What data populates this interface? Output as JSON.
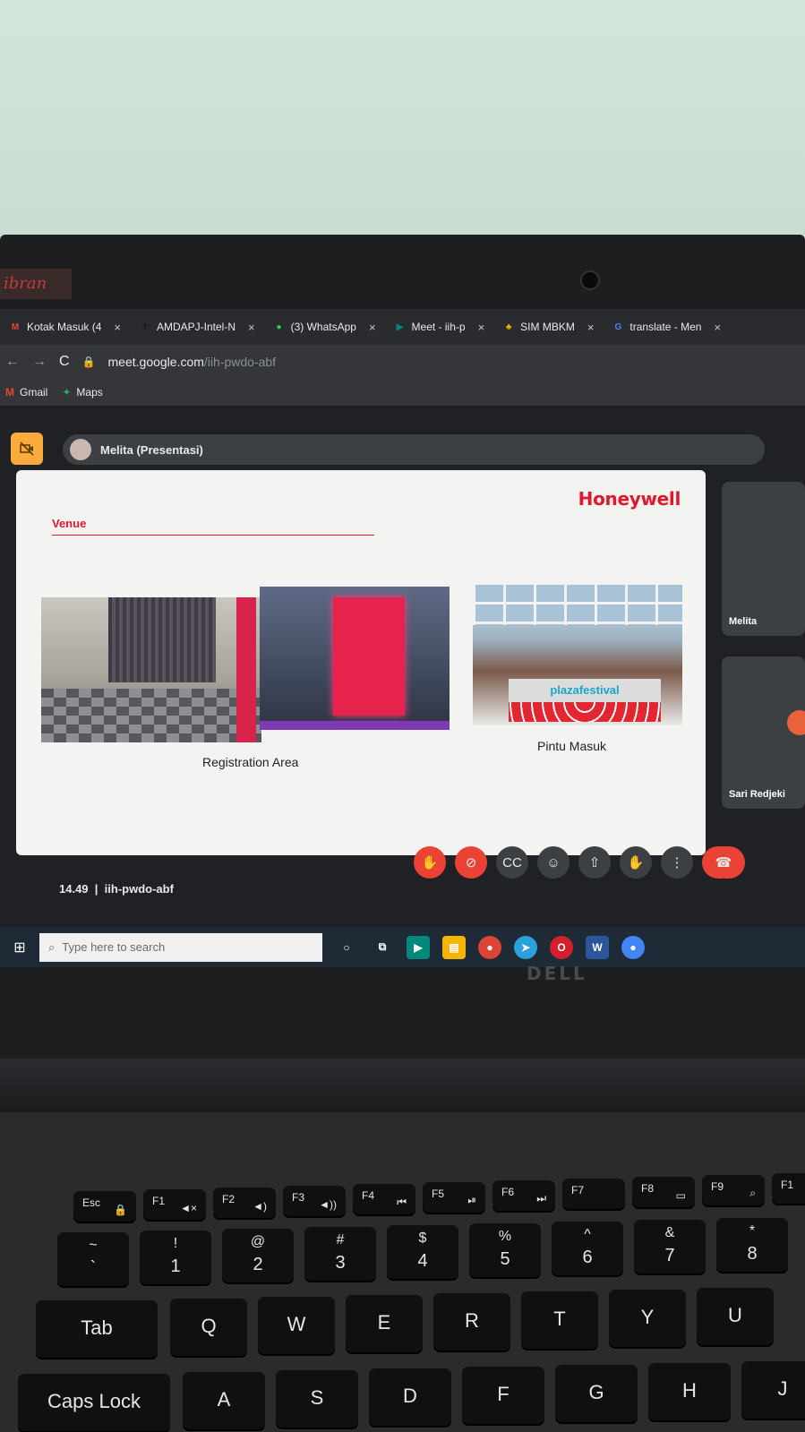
{
  "browser": {
    "tabs": [
      {
        "icon": "gmail-icon",
        "icon_text": "M",
        "icon_color": "#ea4335",
        "label": "Kotak Masuk (4",
        "close": "×"
      },
      {
        "icon": "amdapj-icon",
        "icon_text": "✝",
        "icon_color": "#1a1a1a",
        "label": "AMDAPJ-Intel-N",
        "close": "×"
      },
      {
        "icon": "whatsapp-icon",
        "icon_text": "●",
        "icon_color": "#25d366",
        "label": "(3) WhatsApp",
        "close": "×"
      },
      {
        "icon": "meet-icon",
        "icon_text": "▶",
        "icon_color": "#00897b",
        "label": "Meet - iih-p",
        "close": "×"
      },
      {
        "icon": "sim-icon",
        "icon_text": "♣",
        "icon_color": "#f4b400",
        "label": "SIM MBKM",
        "close": "×"
      },
      {
        "icon": "translate-icon",
        "icon_text": "G",
        "icon_color": "#4285f4",
        "label": "translate - Men",
        "close": "×"
      }
    ],
    "url_host": "meet.google.com",
    "url_path": "/iih-pwdo-abf",
    "bookmarks": [
      {
        "icon": "gmail-icon",
        "label": "Gmail"
      },
      {
        "icon": "maps-icon",
        "label": "Maps"
      }
    ]
  },
  "meet": {
    "presenter_label": "Melita (Presentasi)",
    "slide": {
      "brand": "Honeywell",
      "section_title": "Venue",
      "caption_left": "Registration Area",
      "caption_right": "Pintu Masuk",
      "sign_text": "plazafestival"
    },
    "participants": [
      "Melita",
      "Sari Redjeki"
    ],
    "time": "14.49",
    "separator": "|",
    "meeting_code": "iih-pwdo-abf",
    "controls": [
      {
        "name": "mic-off-button",
        "icon": "mic-off-icon",
        "glyph": "✋"
      },
      {
        "name": "camera-off-button",
        "icon": "camera-off-icon",
        "glyph": "⊘"
      },
      {
        "name": "captions-button",
        "icon": "captions-icon",
        "glyph": "CC"
      },
      {
        "name": "emoji-button",
        "icon": "emoji-icon",
        "glyph": "☺"
      },
      {
        "name": "present-button",
        "icon": "present-icon",
        "glyph": "⇧"
      },
      {
        "name": "raise-hand-button",
        "icon": "raise-hand-icon",
        "glyph": "✋"
      },
      {
        "name": "more-options-button",
        "icon": "more-vert-icon",
        "glyph": "⋮"
      }
    ],
    "end_call_glyph": "☎"
  },
  "taskbar": {
    "search_placeholder": "Type here to search"
  },
  "laptop": {
    "brand": "DELL",
    "sticker": "ibran"
  },
  "keyboard": {
    "fkeys": [
      {
        "label": "Esc",
        "sym": "🔒"
      },
      {
        "label": "F1",
        "sym": "◄×"
      },
      {
        "label": "F2",
        "sym": "◄)"
      },
      {
        "label": "F3",
        "sym": "◄))"
      },
      {
        "label": "F4",
        "sym": "⏮"
      },
      {
        "label": "F5",
        "sym": "⏯"
      },
      {
        "label": "F6",
        "sym": "⏭"
      },
      {
        "label": "F7",
        "sym": ""
      },
      {
        "label": "F8",
        "sym": "▭"
      },
      {
        "label": "F9",
        "sym": "⌕"
      },
      {
        "label": "F1",
        "sym": ""
      }
    ],
    "number_row": [
      {
        "top": "~",
        "bot": "`"
      },
      {
        "top": "!",
        "bot": "1"
      },
      {
        "top": "@",
        "bot": "2"
      },
      {
        "top": "#",
        "bot": "3"
      },
      {
        "top": "$",
        "bot": "4"
      },
      {
        "top": "%",
        "bot": "5"
      },
      {
        "top": "^",
        "bot": "6"
      },
      {
        "top": "&",
        "bot": "7"
      },
      {
        "top": "*",
        "bot": "8"
      }
    ],
    "letter_row": [
      "Tab",
      "Q",
      "W",
      "E",
      "R",
      "T",
      "Y",
      "U"
    ],
    "home_row": [
      "Caps Lock",
      "A",
      "S",
      "D",
      "F",
      "G",
      "H",
      "J"
    ]
  }
}
